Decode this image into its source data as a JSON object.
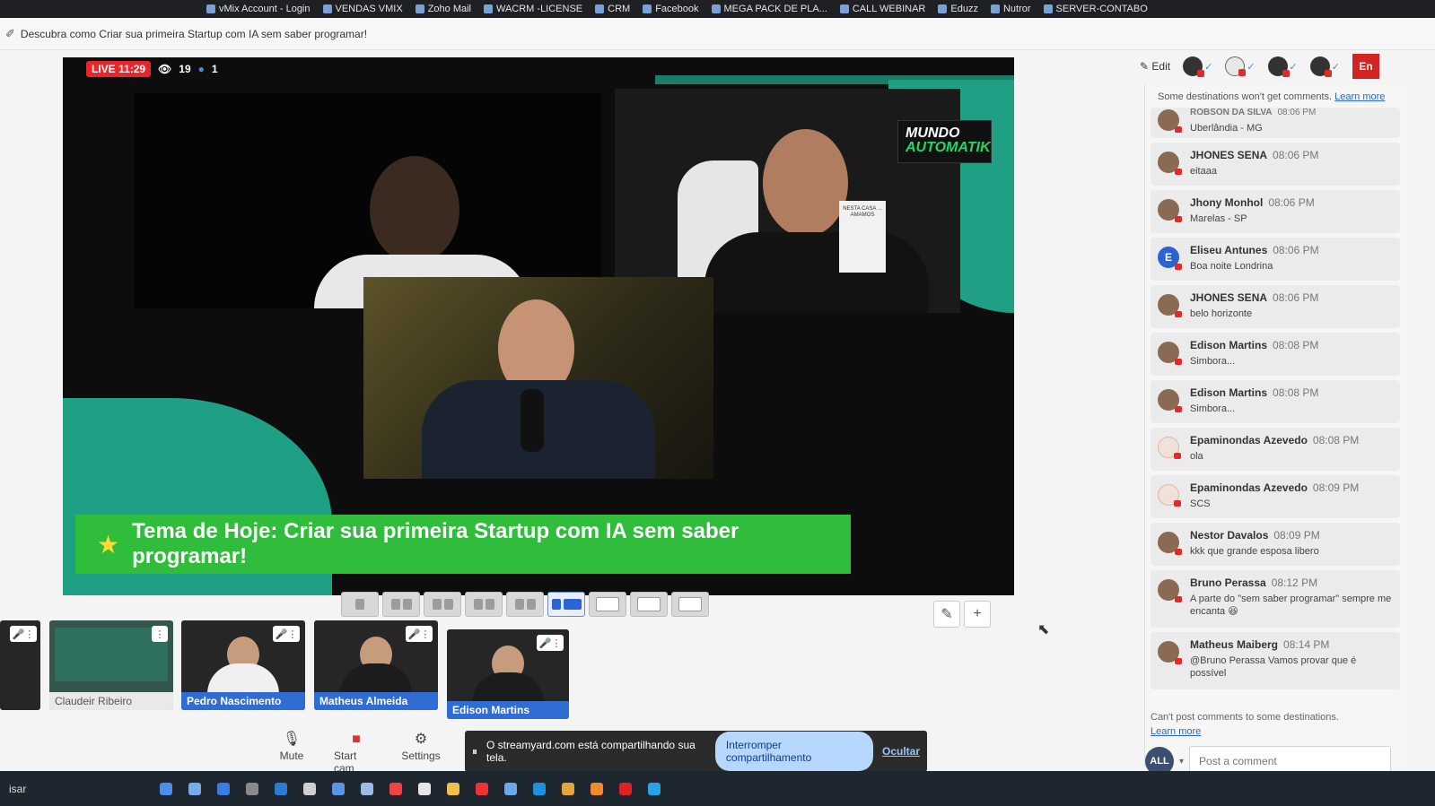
{
  "bookmarks": [
    {
      "label": "vMix Account - Login"
    },
    {
      "label": "VENDAS VMIX"
    },
    {
      "label": "Zoho Mail"
    },
    {
      "label": "WACRM -LICENSE"
    },
    {
      "label": "CRM"
    },
    {
      "label": "Facebook"
    },
    {
      "label": "MEGA PACK DE PLA..."
    },
    {
      "label": "CALL WEBINAR"
    },
    {
      "label": "Eduzz"
    },
    {
      "label": "Nutror"
    },
    {
      "label": "SERVER-CONTABO"
    }
  ],
  "tab": {
    "title": "Descubra como Criar sua primeira Startup com IA sem saber programar!"
  },
  "stage": {
    "live_label": "LIVE 11:29",
    "viewers": "19",
    "likes": "1",
    "logo_line1": "MUNDO",
    "logo_line2": "AUTOMATIK",
    "poster_text": "NESTA CASA ... AMAMOS",
    "banner": "Tema de Hoje: Criar sua primeira Startup com IA sem saber programar!"
  },
  "participants": [
    {
      "name": "Claudeir Ribeiro",
      "on_stage": false
    },
    {
      "name": "Pedro Nascimento",
      "on_stage": true
    },
    {
      "name": "Matheus Almeida",
      "on_stage": true
    },
    {
      "name": "Edison Martins",
      "on_stage": true
    }
  ],
  "controls": {
    "mute": "Mute",
    "start_cam": "Start cam",
    "settings": "Settings",
    "share_msg": "O streamyard.com está compartilhando sua tela.",
    "stop_share": "Interromper compartilhamento",
    "hide": "Ocultar"
  },
  "header": {
    "edit": "Edit",
    "end_label": "En"
  },
  "chat": {
    "notice": "Some destinations won't get comments.",
    "notice_link": "Learn more",
    "messages": [
      {
        "name": "ROBSON DA SILVA",
        "time": "08:06 PM",
        "text": "Uberlândia - MG"
      },
      {
        "name": "JHONES SENA",
        "time": "08:06 PM",
        "text": "eitaaa"
      },
      {
        "name": "Jhony Monhol",
        "time": "08:06 PM",
        "text": "Marelas - SP"
      },
      {
        "name": "Eliseu Antunes",
        "time": "08:06 PM",
        "text": "Boa noite Londrina",
        "initial": "E"
      },
      {
        "name": "JHONES SENA",
        "time": "08:06 PM",
        "text": "belo horizonte"
      },
      {
        "name": "Edison Martins",
        "time": "08:08 PM",
        "text": "Simbora..."
      },
      {
        "name": "Edison Martins",
        "time": "08:08 PM",
        "text": "Simbora..."
      },
      {
        "name": "Epaminondas Azevedo",
        "time": "08:08 PM",
        "text": "ola"
      },
      {
        "name": "Epaminondas Azevedo",
        "time": "08:09 PM",
        "text": "SCS"
      },
      {
        "name": "Nestor Davalos",
        "time": "08:09 PM",
        "text": "kkk que grande esposa libero"
      },
      {
        "name": "Bruno Perassa",
        "time": "08:12 PM",
        "text": "A parte do \"sem saber programar\" sempre me encanta 😆"
      },
      {
        "name": "Matheus Maiberg",
        "time": "08:14 PM",
        "text": "@Bruno Perassa Vamos provar que é possível"
      }
    ],
    "footer": "Can't post comments to some destinations.",
    "footer_link": "Learn more",
    "all": "ALL",
    "placeholder": "Post a comment"
  },
  "taskbar": {
    "search": "isar"
  },
  "colors": {
    "live": "#e5262c",
    "banner": "#2fbd3b",
    "accent_blue": "#2f6dd5",
    "brand_green": "#1fa085"
  }
}
